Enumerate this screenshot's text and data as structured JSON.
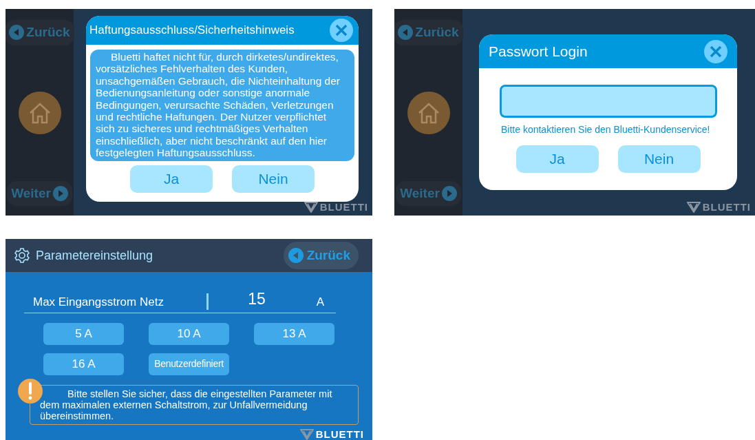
{
  "disclaimer_screen": {
    "sidebar": {
      "back_label": "Zurück",
      "next_label": "Weiter"
    },
    "dialog": {
      "title": "Haftungsausschluss/Sicherheitshinweis",
      "text": "Bluetti haftet nicht für, durch dirketes/undirektes, vorsätzliches Fehlverhalten des Kunden, unsachgemäßen Gebrauch, die Nichteinhaltung der Bedienungsanleitung oder sonstige anormale Bedingungen, verursachte Schäden, Verletzungen und rechtliche Haftungen. Der Nutzer verpflichtet sich zu sicheres und rechtmäßiges Verhalten einschließlich, aber nicht beschränkt auf den hier festgelegten Haftungsausschluss.",
      "buttons": [
        "Ja",
        "Nein"
      ]
    },
    "logo": "BLUETTI"
  },
  "login_screen": {
    "sidebar": {
      "back_label": "Zurück",
      "next_label": "Weiter"
    },
    "dialog": {
      "title": "Passwort Login",
      "hint": "Bitte kontaktieren Sie den Bluetti-Kundenservice!",
      "buttons": [
        "Ja",
        "Nein"
      ]
    },
    "logo": "BLUETTI"
  },
  "settings_screen": {
    "title": "Parametereinstellung",
    "back_label": "Zurück",
    "parameter": {
      "label": "Max Eingangsstrom Netz",
      "value": "15",
      "unit": "A"
    },
    "presets": [
      "5 A",
      "10 A",
      "13 A",
      "16 A",
      "Benutzerdefiniert"
    ],
    "warning": "Bitte stellen Sie sicher, dass die eingestellten Parameter mit dem maximalen externen Schaltstrom, zur Unfallvermeidung übereinstimmen.",
    "logo": "BLUETTI"
  }
}
